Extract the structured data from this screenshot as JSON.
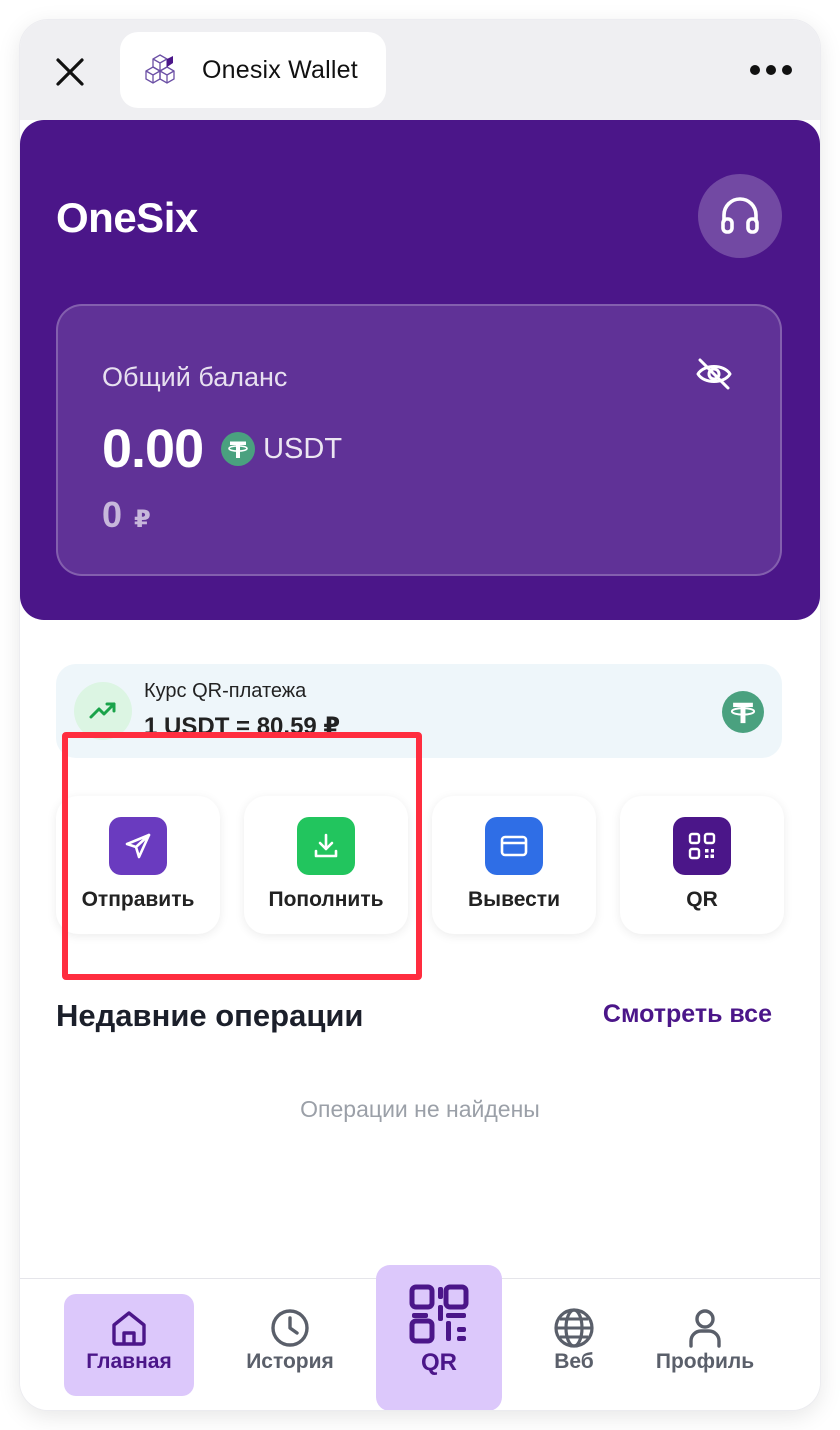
{
  "window": {
    "app_title": "Onesix Wallet"
  },
  "header": {
    "brand": "OneSix"
  },
  "balance": {
    "label": "Общий баланс",
    "amount": "0.00",
    "currency": "USDT",
    "fiat_amount": "0",
    "fiat_currency": "₽"
  },
  "rate": {
    "title": "Курс QR-платежа",
    "value": "1 USDT = 80.59 ₽"
  },
  "actions": [
    {
      "label": "Отправить",
      "icon": "send-icon",
      "color": "#6a3bbf"
    },
    {
      "label": "Пополнить",
      "icon": "download-icon",
      "color": "#22c55e"
    },
    {
      "label": "Вывести",
      "icon": "card-icon",
      "color": "#2f6ee6"
    },
    {
      "label": "QR",
      "icon": "qr-icon",
      "color": "#4b1689"
    }
  ],
  "recent": {
    "title": "Недавние операции",
    "see_all": "Смотреть все",
    "empty": "Операции не найдены"
  },
  "nav": {
    "home": "Главная",
    "history": "История",
    "qr": "QR",
    "web": "Веб",
    "profile": "Профиль"
  },
  "colors": {
    "brand_purple": "#4b1689",
    "highlight_red": "#ff2d3f",
    "tether_green": "#4aa17f"
  }
}
